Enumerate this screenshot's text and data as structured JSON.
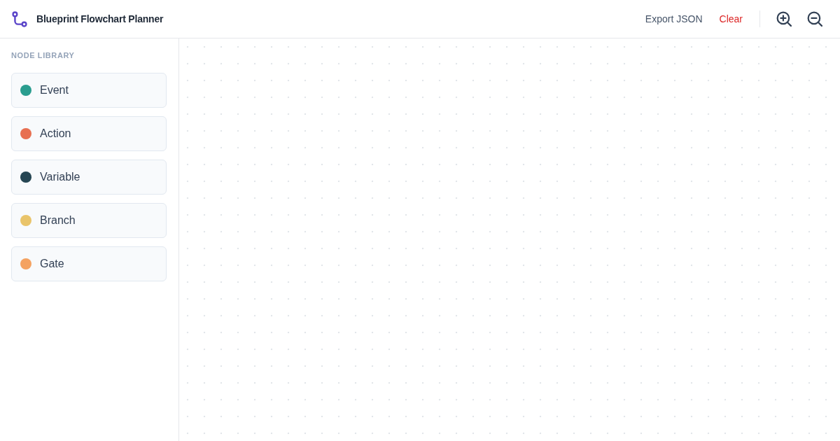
{
  "header": {
    "title": "Blueprint Flowchart Planner",
    "actions": [
      {
        "label": "Export JSON",
        "kind": "default"
      },
      {
        "label": "Clear",
        "kind": "danger"
      }
    ]
  },
  "sidebar": {
    "heading": "NODE LIBRARY",
    "items": [
      {
        "label": "Event",
        "color": "#2a9d8f"
      },
      {
        "label": "Action",
        "color": "#e76f51"
      },
      {
        "label": "Variable",
        "color": "#264653"
      },
      {
        "label": "Branch",
        "color": "#e9c46a"
      },
      {
        "label": "Gate",
        "color": "#f4a261"
      }
    ]
  }
}
